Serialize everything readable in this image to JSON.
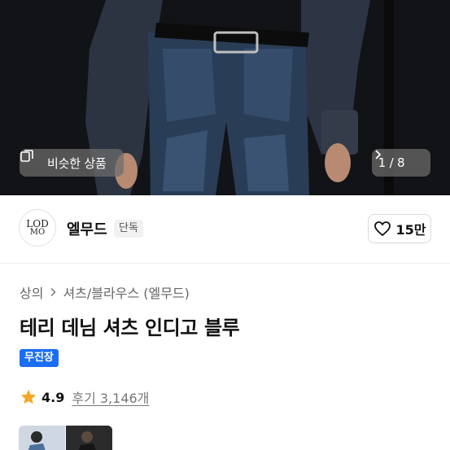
{
  "hero": {
    "similar_label": "비슷한 상품",
    "counter": "1 / 8"
  },
  "brand": {
    "logo_text_top": "LOD",
    "logo_text_bottom": "MO",
    "name": "엘무드",
    "badge": "단독",
    "likes": "15만"
  },
  "product": {
    "breadcrumb": [
      "상의",
      "셔츠/블라우스 (엘무드)"
    ],
    "title": "테리 데님 셔츠 인디고 블루",
    "tag": "무진장",
    "rating": "4.9",
    "reviews": "후기 3,146개"
  },
  "colors": {
    "accent": "#1b6ef3",
    "star": "#f5a623"
  }
}
